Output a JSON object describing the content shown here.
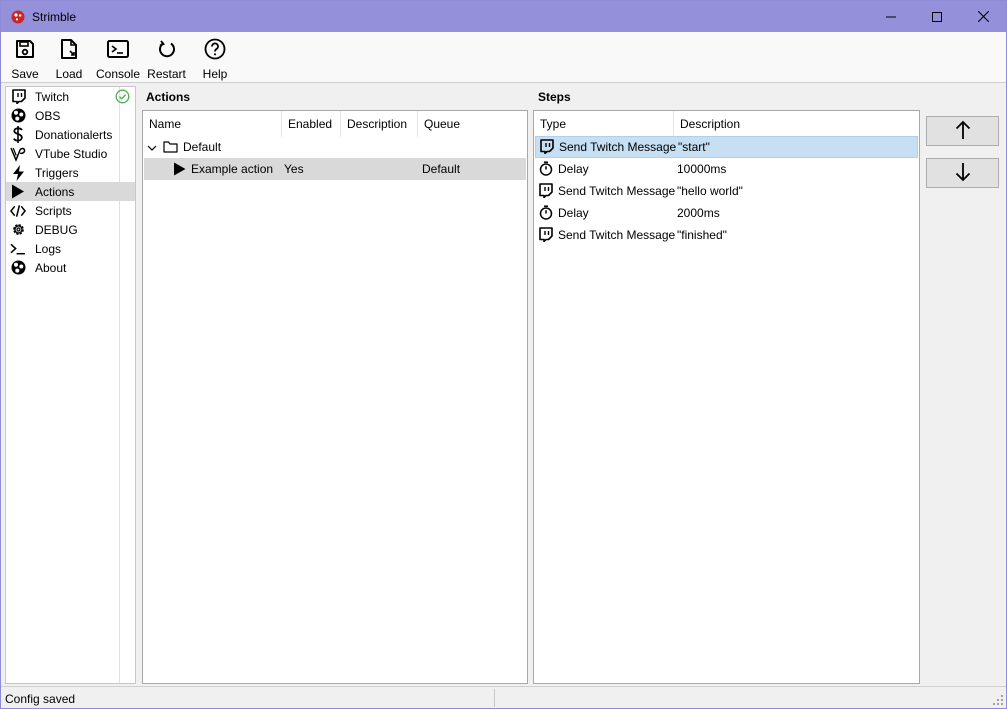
{
  "window": {
    "title": "Strimble",
    "accent": "#9490da"
  },
  "toolbar": {
    "items": [
      {
        "label": "Save",
        "icon": "save-icon"
      },
      {
        "label": "Load",
        "icon": "load-icon"
      },
      {
        "label": "Console",
        "icon": "console-icon"
      },
      {
        "label": "Restart",
        "icon": "restart-icon"
      },
      {
        "label": "Help",
        "icon": "help-icon"
      }
    ]
  },
  "sidebar": {
    "items": [
      {
        "label": "Twitch",
        "icon": "twitch-icon",
        "status": "connected"
      },
      {
        "label": "OBS",
        "icon": "obs-icon"
      },
      {
        "label": "Donationalerts",
        "icon": "dollar-icon"
      },
      {
        "label": "VTube Studio",
        "icon": "vtube-studio-icon"
      },
      {
        "label": "Triggers",
        "icon": "lightning-icon"
      },
      {
        "label": "Actions",
        "icon": "play-icon",
        "selected": true
      },
      {
        "label": "Scripts",
        "icon": "code-icon"
      },
      {
        "label": "DEBUG",
        "icon": "gear-icon"
      },
      {
        "label": "Logs",
        "icon": "terminal-icon"
      },
      {
        "label": "About",
        "icon": "about-icon"
      }
    ]
  },
  "actions": {
    "title": "Actions",
    "columns": [
      "Name",
      "Enabled",
      "Description",
      "Queue"
    ],
    "groups": [
      {
        "name": "Default",
        "expanded": true,
        "items": [
          {
            "name": "Example action",
            "enabled": "Yes",
            "description": "",
            "queue": "Default",
            "selected": true
          }
        ]
      }
    ]
  },
  "steps": {
    "title": "Steps",
    "columns": [
      "Type",
      "Description"
    ],
    "rows": [
      {
        "type": "Send Twitch Message",
        "icon": "twitch-icon",
        "description": "\"start\"",
        "selected": true
      },
      {
        "type": "Delay",
        "icon": "stopwatch-icon",
        "description": "10000ms"
      },
      {
        "type": "Send Twitch Message",
        "icon": "twitch-icon",
        "description": "\"hello world\""
      },
      {
        "type": "Delay",
        "icon": "stopwatch-icon",
        "description": "2000ms"
      },
      {
        "type": "Send Twitch Message",
        "icon": "twitch-icon",
        "description": "\"finished\""
      }
    ]
  },
  "buttons": {
    "move_up": "arrow-up-icon",
    "move_down": "arrow-down-icon"
  },
  "statusbar": {
    "text": "Config saved"
  }
}
